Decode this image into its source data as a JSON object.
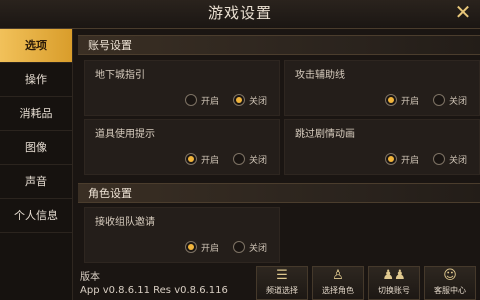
{
  "window": {
    "title": "游戏设置",
    "close_icon": "close-x"
  },
  "sidebar": {
    "items": [
      {
        "label": "选项",
        "active": true
      },
      {
        "label": "操作",
        "active": false
      },
      {
        "label": "消耗品",
        "active": false
      },
      {
        "label": "图像",
        "active": false
      },
      {
        "label": "声音",
        "active": false
      },
      {
        "label": "个人信息",
        "active": false
      }
    ]
  },
  "sections": {
    "account": {
      "title": "账号设置"
    },
    "role": {
      "title": "角色设置"
    }
  },
  "settings": [
    {
      "label": "地下城指引",
      "on_label": "开启",
      "off_label": "关闭",
      "value": "关闭"
    },
    {
      "label": "攻击辅助线",
      "on_label": "开启",
      "off_label": "关闭",
      "value": "开启"
    },
    {
      "label": "道具使用提示",
      "on_label": "开启",
      "off_label": "关闭",
      "value": "开启"
    },
    {
      "label": "跳过剧情动画",
      "on_label": "开启",
      "off_label": "关闭",
      "value": "开启"
    },
    {
      "label": "接收组队邀请",
      "on_label": "开启",
      "off_label": "关闭",
      "value": "开启"
    }
  ],
  "version": {
    "label": "版本",
    "value": "App v0.8.6.11 Res v0.8.6.116"
  },
  "bottom_buttons": [
    {
      "label": "频道选择",
      "icon": "list-icon"
    },
    {
      "label": "选择角色",
      "icon": "character-icon"
    },
    {
      "label": "切换账号",
      "icon": "group-icon"
    },
    {
      "label": "客服中心",
      "icon": "support-avatar-icon"
    }
  ],
  "colors": {
    "accent": "#f0b43c",
    "tab_active": "#e8ac3f",
    "background": "#1a1512"
  }
}
